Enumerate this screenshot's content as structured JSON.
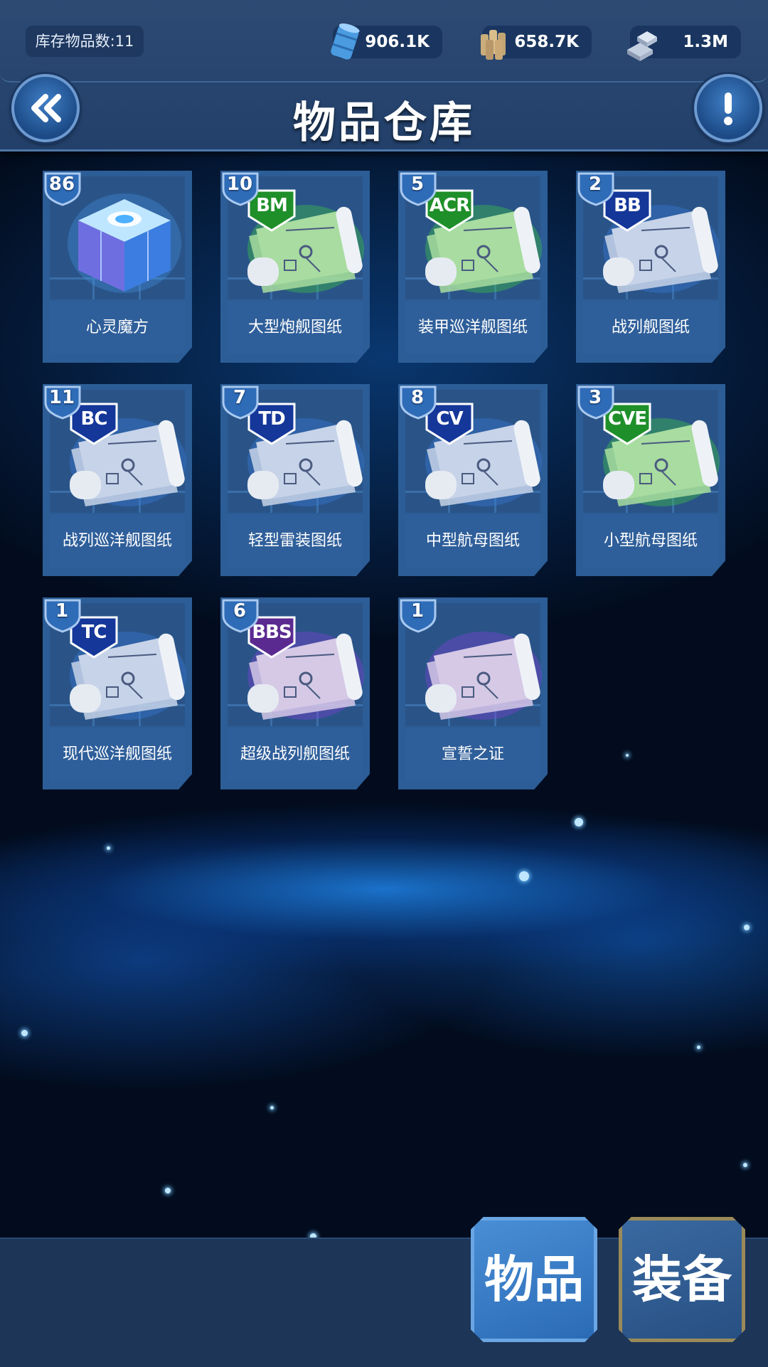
{
  "header": {
    "inventory_count": "库存物品数:11",
    "title": "物品仓库",
    "resources": [
      {
        "icon": "oil-barrel-icon",
        "value": "906.1K"
      },
      {
        "icon": "ammo-shells-icon",
        "value": "658.7K"
      },
      {
        "icon": "steel-ingot-icon",
        "value": "1.3M"
      }
    ]
  },
  "items": [
    {
      "name": "心灵魔方",
      "count": "86",
      "tag": "",
      "color": "cube"
    },
    {
      "name": "大型炮舰图纸",
      "count": "10",
      "tag": "BM",
      "color": "green"
    },
    {
      "name": "装甲巡洋舰图纸",
      "count": "5",
      "tag": "ACR",
      "color": "green"
    },
    {
      "name": "战列舰图纸",
      "count": "2",
      "tag": "BB",
      "color": "blue"
    },
    {
      "name": "战列巡洋舰图纸",
      "count": "11",
      "tag": "BC",
      "color": "blue"
    },
    {
      "name": "轻型雷装图纸",
      "count": "7",
      "tag": "TD",
      "color": "blue"
    },
    {
      "name": "中型航母图纸",
      "count": "8",
      "tag": "CV",
      "color": "blue"
    },
    {
      "name": "小型航母图纸",
      "count": "3",
      "tag": "CVE",
      "color": "green"
    },
    {
      "name": "现代巡洋舰图纸",
      "count": "1",
      "tag": "TC",
      "color": "blue"
    },
    {
      "name": "超级战列舰图纸",
      "count": "6",
      "tag": "BBS",
      "color": "purple"
    },
    {
      "name": "宣誓之证",
      "count": "1",
      "tag": "",
      "color": "purple"
    }
  ],
  "tabs": {
    "items_label": "物品",
    "equipment_label": "装备"
  }
}
